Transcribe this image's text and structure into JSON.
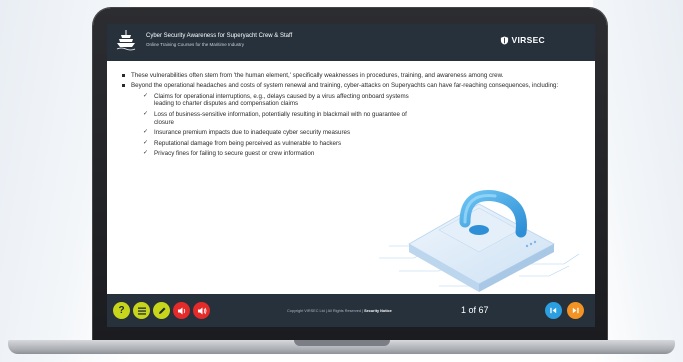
{
  "header": {
    "title": "Cyber Security Awareness for Superyacht Crew & Staff",
    "subtitle": "Online Training Courses for the Maritime Industry",
    "brand": "VIRSEC"
  },
  "content": {
    "bullets": [
      "These vulnerabilities often stem from 'the human element,' specifically weaknesses in procedures, training, and awareness among crew.",
      "Beyond the operational headaches and costs of system renewal and training, cyber-attacks on Superyachts can have far-reaching consequences, including:"
    ],
    "checks": [
      "Claims for operational interruptions, e.g., delays caused by a virus affecting onboard systems leading to charter disputes and compensation claims",
      "Loss of business-sensitive information, potentially resulting in blackmail with no guarantee of closure",
      "Insurance premium impacts due to inadequate cyber security measures",
      "Reputational damage from being perceived as vulnerable to hackers",
      "Privacy fines for failing to secure guest or crew information"
    ]
  },
  "footer": {
    "help_label": "?",
    "copyright_prefix": "Copyright VIRSEC Ltd | All Rights Reserved |",
    "security_notice": "Security Notice",
    "page_count": "1 of 67"
  },
  "colors": {
    "header_bg": "#26313c",
    "accent_yellow": "#c8d61b",
    "accent_red": "#e52a2a",
    "accent_blue": "#2b9fe0",
    "accent_orange": "#f39323"
  },
  "icons": {
    "logo": "ship-icon",
    "help": "question-icon",
    "menu": "list-icon",
    "notes": "pencil-icon",
    "volume": "speaker-icon",
    "first": "first-page-icon",
    "next": "next-page-icon"
  }
}
